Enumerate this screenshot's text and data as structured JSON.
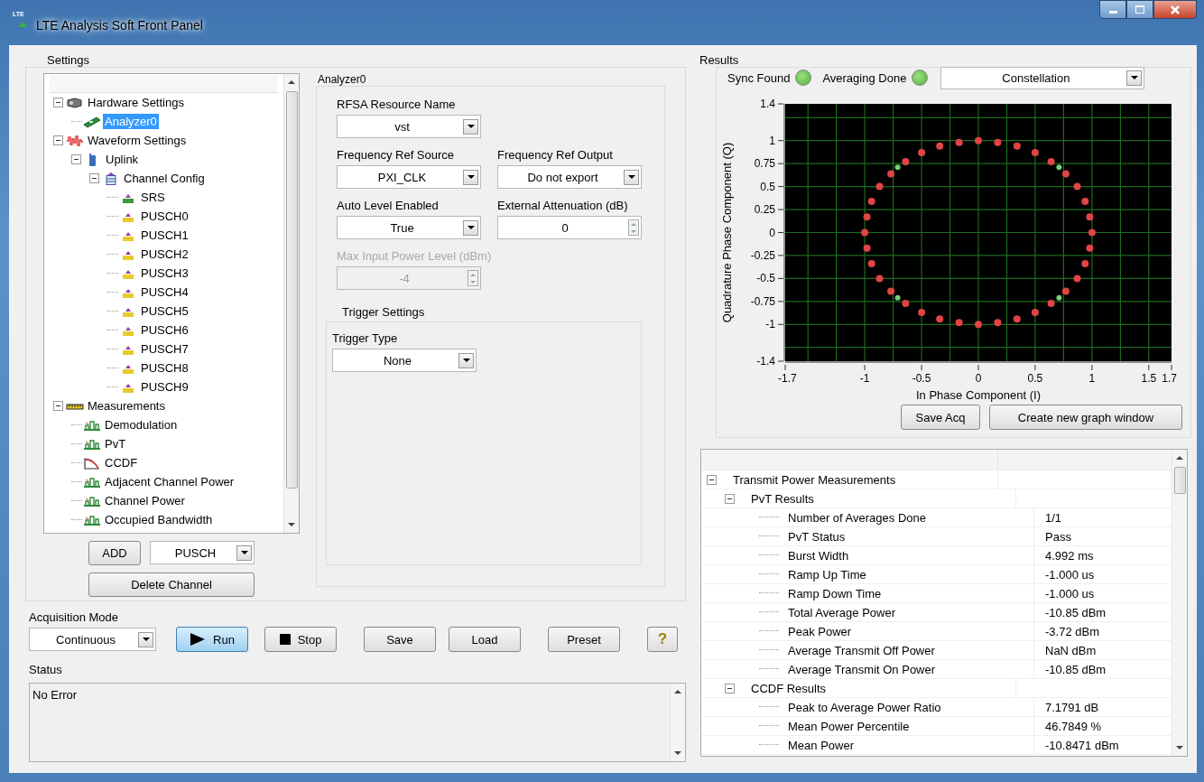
{
  "window": {
    "logo": "LTE",
    "title": "LTE Analysis Soft Front Panel"
  },
  "settings": {
    "title": "Settings",
    "tree": [
      {
        "label": "Hardware Settings",
        "kind": "hardware",
        "expanded": true,
        "selected": false,
        "children": [
          {
            "label": "Analyzer0",
            "kind": "device",
            "selected": true
          }
        ]
      },
      {
        "label": "Waveform Settings",
        "kind": "waveform",
        "expanded": true,
        "selected": false,
        "children": [
          {
            "label": "Uplink",
            "kind": "uplink",
            "expanded": true,
            "selected": false,
            "children": [
              {
                "label": "Channel Config",
                "kind": "config",
                "expanded": true,
                "selected": false,
                "children": [
                  {
                    "label": "SRS",
                    "kind": "channel",
                    "color": "#3c9a3c",
                    "selected": false
                  },
                  {
                    "label": "PUSCH0",
                    "kind": "channel",
                    "color": "#e6cc2a",
                    "selected": false
                  },
                  {
                    "label": "PUSCH1",
                    "kind": "channel",
                    "color": "#e6cc2a",
                    "selected": false
                  },
                  {
                    "label": "PUSCH2",
                    "kind": "channel",
                    "color": "#e6cc2a",
                    "selected": false
                  },
                  {
                    "label": "PUSCH3",
                    "kind": "channel",
                    "color": "#e6cc2a",
                    "selected": false
                  },
                  {
                    "label": "PUSCH4",
                    "kind": "channel",
                    "color": "#e6cc2a",
                    "selected": false
                  },
                  {
                    "label": "PUSCH5",
                    "kind": "channel",
                    "color": "#e6cc2a",
                    "selected": false
                  },
                  {
                    "label": "PUSCH6",
                    "kind": "channel",
                    "color": "#e6cc2a",
                    "selected": false
                  },
                  {
                    "label": "PUSCH7",
                    "kind": "channel",
                    "color": "#e6cc2a",
                    "selected": false
                  },
                  {
                    "label": "PUSCH8",
                    "kind": "channel",
                    "color": "#e6cc2a",
                    "selected": false
                  },
                  {
                    "label": "PUSCH9",
                    "kind": "channel",
                    "color": "#e6cc2a",
                    "selected": false
                  }
                ]
              }
            ]
          }
        ]
      },
      {
        "label": "Measurements",
        "kind": "measurements",
        "expanded": true,
        "selected": false,
        "children": [
          {
            "label": "Demodulation",
            "kind": "demod",
            "selected": false
          },
          {
            "label": "PvT",
            "kind": "pvt",
            "selected": false
          },
          {
            "label": "CCDF",
            "kind": "ccdf",
            "selected": false
          },
          {
            "label": "Adjacent Channel Power",
            "kind": "acp",
            "selected": false
          },
          {
            "label": "Channel Power",
            "kind": "chpower",
            "selected": false
          },
          {
            "label": "Occupied Bandwidth",
            "kind": "obw",
            "selected": false
          }
        ]
      }
    ],
    "add_button": "ADD",
    "channel_type": "PUSCH",
    "delete_button": "Delete Channel"
  },
  "analyzer": {
    "title": "Analyzer0",
    "rows": [
      [
        {
          "kind": "dropdown",
          "label": "RFSA Resource Name",
          "value": "vst",
          "disabled": false
        }
      ],
      [
        {
          "kind": "dropdown",
          "label": "Frequency Ref Source",
          "value": "PXI_CLK",
          "disabled": false
        },
        {
          "kind": "dropdown",
          "label": "Frequency Ref Output",
          "value": "Do not export",
          "disabled": false
        }
      ],
      [
        {
          "kind": "dropdown",
          "label": "Auto Level Enabled",
          "value": "True",
          "disabled": false
        },
        {
          "kind": "numeric",
          "label": "External Attenuation (dB)",
          "value": "0",
          "disabled": false
        }
      ],
      [
        {
          "kind": "numeric",
          "label": "Max Input Power Level (dBm)",
          "value": "-4",
          "disabled": true
        }
      ]
    ],
    "trigger": {
      "title": "Trigger Settings",
      "fields": [
        {
          "kind": "dropdown",
          "label": "Trigger Type",
          "value": "None",
          "disabled": false
        }
      ]
    }
  },
  "acquisition": {
    "label": "Acquisition Mode",
    "value": "Continuous"
  },
  "buttons": [
    {
      "kind": "run",
      "label": "Run",
      "active": true
    },
    {
      "kind": "stop",
      "label": "Stop",
      "active": false
    },
    {
      "kind": "plain",
      "label": "Save",
      "active": false
    },
    {
      "kind": "plain",
      "label": "Load",
      "active": false
    },
    {
      "kind": "plain",
      "label": "Preset",
      "active": false
    },
    {
      "kind": "help",
      "label": "?",
      "active": false
    }
  ],
  "status": {
    "label": "Status",
    "text": "No Error"
  },
  "results": {
    "title": "Results",
    "indicators": [
      {
        "label": "Sync Found",
        "on": true
      },
      {
        "label": "Averaging Done",
        "on": true
      }
    ],
    "view": "Constellation",
    "chart_data": {
      "type": "scatter",
      "xlabel": "In Phase Component (I)",
      "ylabel": "Quadrature Phase Component (Q)",
      "x": [
        1,
        0.98,
        0.94,
        0.87,
        0.77,
        0.64,
        0.5,
        0.34,
        0.17,
        0,
        -0.17,
        -0.34,
        -0.5,
        -0.64,
        -0.77,
        -0.87,
        -0.94,
        -0.98,
        -1,
        -0.98,
        -0.94,
        -0.87,
        -0.77,
        -0.64,
        -0.5,
        -0.34,
        -0.17,
        0,
        0.17,
        0.34,
        0.5,
        0.64,
        0.77,
        0.87,
        0.94,
        0.98,
        0.71,
        -0.71,
        -0.71,
        0.71
      ],
      "series": [
        {
          "color": "#e04444",
          "values": [
            0,
            0.17,
            0.34,
            0.5,
            0.64,
            0.77,
            0.87,
            0.94,
            0.98,
            1,
            0.98,
            0.94,
            0.87,
            0.77,
            0.64,
            0.5,
            0.34,
            0.17,
            0,
            -0.17,
            -0.34,
            -0.5,
            -0.64,
            -0.77,
            -0.87,
            -0.94,
            -0.98,
            -1,
            -0.98,
            -0.94,
            -0.87,
            -0.77,
            -0.64,
            -0.5,
            -0.34,
            -0.17,
            null,
            null,
            null,
            null
          ]
        },
        {
          "color": "#74d074",
          "values": [
            null,
            null,
            null,
            null,
            null,
            null,
            null,
            null,
            null,
            null,
            null,
            null,
            null,
            null,
            null,
            null,
            null,
            null,
            null,
            null,
            null,
            null,
            null,
            null,
            null,
            null,
            null,
            null,
            null,
            null,
            null,
            null,
            null,
            null,
            null,
            null,
            0.71,
            0.71,
            -0.71,
            -0.71
          ]
        }
      ],
      "grid": true,
      "xlim": [
        -1.7,
        1.7
      ],
      "ylim": [
        -1.4,
        1.4
      ],
      "xticks": [
        -1.7,
        -1,
        -0.5,
        0,
        0.5,
        1,
        1.5,
        1.7
      ],
      "yticks": [
        -1.4,
        -1,
        -0.75,
        -0.5,
        -0.25,
        0,
        0.25,
        0.5,
        0.75,
        1,
        1.4
      ]
    },
    "buttons": [
      "Save Acq",
      "Create new graph window"
    ],
    "table": [
      {
        "label": "Transmit Power Measurements",
        "expanded": true,
        "children": [
          {
            "label": "PvT Results",
            "expanded": true,
            "children": [
              {
                "label": "Number of Averages Done",
                "value": "1/1"
              },
              {
                "label": "PvT Status",
                "value": "Pass"
              },
              {
                "label": "Burst Width",
                "value": "4.992 ms"
              },
              {
                "label": "Ramp Up Time",
                "value": "-1.000 us"
              },
              {
                "label": "Ramp Down Time",
                "value": "-1.000 us"
              },
              {
                "label": "Total Average Power",
                "value": "-10.85 dBm"
              },
              {
                "label": "Peak Power",
                "value": "-3.72 dBm"
              },
              {
                "label": "Average Transmit Off Power",
                "value": "NaN dBm"
              },
              {
                "label": "Average Transmit On Power",
                "value": "-10.85 dBm"
              }
            ]
          },
          {
            "label": "CCDF Results",
            "expanded": true,
            "children": [
              {
                "label": "Peak to Average Power Ratio",
                "value": "7.1791 dB"
              },
              {
                "label": "Mean Power Percentile",
                "value": "46.7849 %"
              },
              {
                "label": "Mean Power",
                "value": "-10.8471 dBm"
              }
            ]
          }
        ]
      }
    ]
  }
}
